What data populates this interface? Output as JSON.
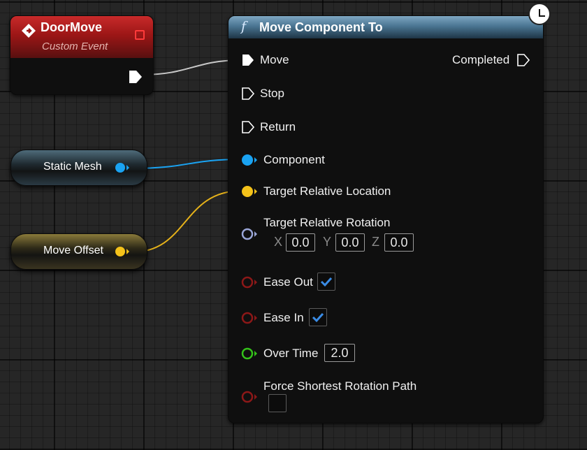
{
  "event_node": {
    "title": "DoorMove",
    "subtitle": "Custom Event"
  },
  "variables": {
    "static_mesh": "Static Mesh",
    "move_offset": "Move Offset"
  },
  "function_node": {
    "title": "Move Component To",
    "exec_in": [
      "Move",
      "Stop",
      "Return"
    ],
    "exec_out": "Completed",
    "component_label": "Component",
    "target_location_label": "Target Relative Location",
    "target_rotation_label": "Target Relative Rotation",
    "rotation": {
      "x_label": "X",
      "x": "0.0",
      "y_label": "Y",
      "y": "0.0",
      "z_label": "Z",
      "z": "0.0"
    },
    "ease_out_label": "Ease Out",
    "ease_out_checked": true,
    "ease_in_label": "Ease In",
    "ease_in_checked": true,
    "over_time_label": "Over Time",
    "over_time_value": "2.0",
    "force_shortest_label": "Force Shortest Rotation Path",
    "force_shortest_checked": false
  },
  "colors": {
    "exec": "#ffffff",
    "object_pin": "#1aa3f2",
    "vector_pin": "#f4c21a",
    "rotator_pin": "#9aa6d8",
    "bool_pin": "#8c1818",
    "float_pin": "#34c21a",
    "event_header": "#9c1616",
    "function_header": "#4a7592",
    "check_blue": "#3a8ce6"
  }
}
